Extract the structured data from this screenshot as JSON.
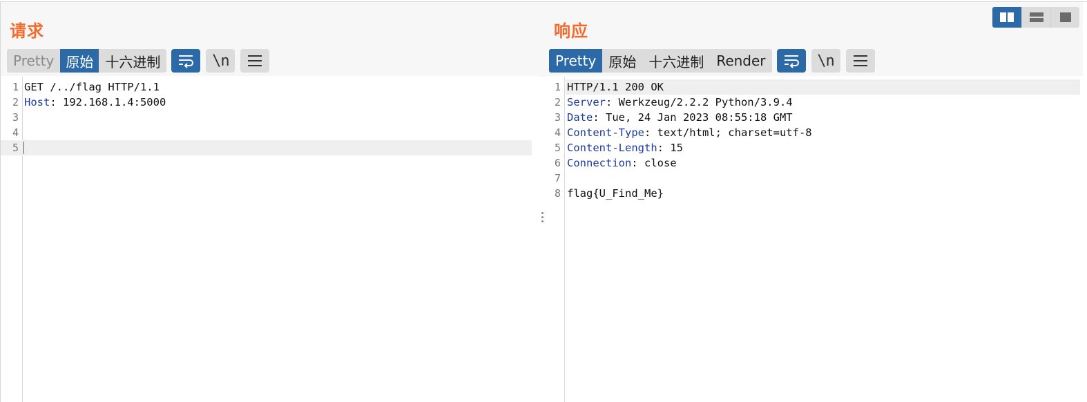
{
  "request": {
    "title": "请求",
    "tabs": [
      {
        "label": "Pretty",
        "state": "disabled"
      },
      {
        "label": "原始",
        "state": "active"
      },
      {
        "label": "十六进制",
        "state": "normal"
      }
    ],
    "tool_icons": [
      "wrap-lines-icon",
      "show-newlines-icon",
      "menu-icon"
    ],
    "newline_glyph": "\\n",
    "lines": [
      {
        "n": "1",
        "key": "",
        "rest": "GET /../flag HTTP/1.1"
      },
      {
        "n": "2",
        "key": "Host",
        "rest": ": 192.168.1.4:5000"
      },
      {
        "n": "3",
        "key": "",
        "rest": ""
      },
      {
        "n": "4",
        "key": "",
        "rest": ""
      },
      {
        "n": "5",
        "key": "",
        "rest": ""
      }
    ]
  },
  "response": {
    "title": "响应",
    "tabs": [
      {
        "label": "Pretty",
        "state": "active"
      },
      {
        "label": "原始",
        "state": "normal"
      },
      {
        "label": "十六进制",
        "state": "normal"
      },
      {
        "label": "Render",
        "state": "normal"
      }
    ],
    "tool_icons": [
      "wrap-lines-icon",
      "show-newlines-icon",
      "menu-icon"
    ],
    "newline_glyph": "\\n",
    "lines": [
      {
        "n": "1",
        "key": "",
        "rest": "HTTP/1.1 200 OK"
      },
      {
        "n": "2",
        "key": "Server",
        "rest": ": Werkzeug/2.2.2 Python/3.9.4"
      },
      {
        "n": "3",
        "key": "Date",
        "rest": ": Tue, 24 Jan 2023 08:55:18 GMT"
      },
      {
        "n": "4",
        "key": "Content-Type",
        "rest": ": text/html; charset=utf-8"
      },
      {
        "n": "5",
        "key": "Content-Length",
        "rest": ": 15"
      },
      {
        "n": "6",
        "key": "Connection",
        "rest": ": close"
      },
      {
        "n": "7",
        "key": "",
        "rest": ""
      },
      {
        "n": "8",
        "key": "",
        "rest": "flag{U_Find_Me}"
      }
    ]
  },
  "layout_switch": {
    "buttons": [
      {
        "icon": "split-columns-icon",
        "active": true
      },
      {
        "icon": "split-rows-icon",
        "active": false
      },
      {
        "icon": "single-pane-icon",
        "active": false
      }
    ]
  },
  "colors": {
    "title_orange": "#f26b2c",
    "accent_blue": "#2b6aa7",
    "header_key_blue": "#1c3aa0"
  }
}
